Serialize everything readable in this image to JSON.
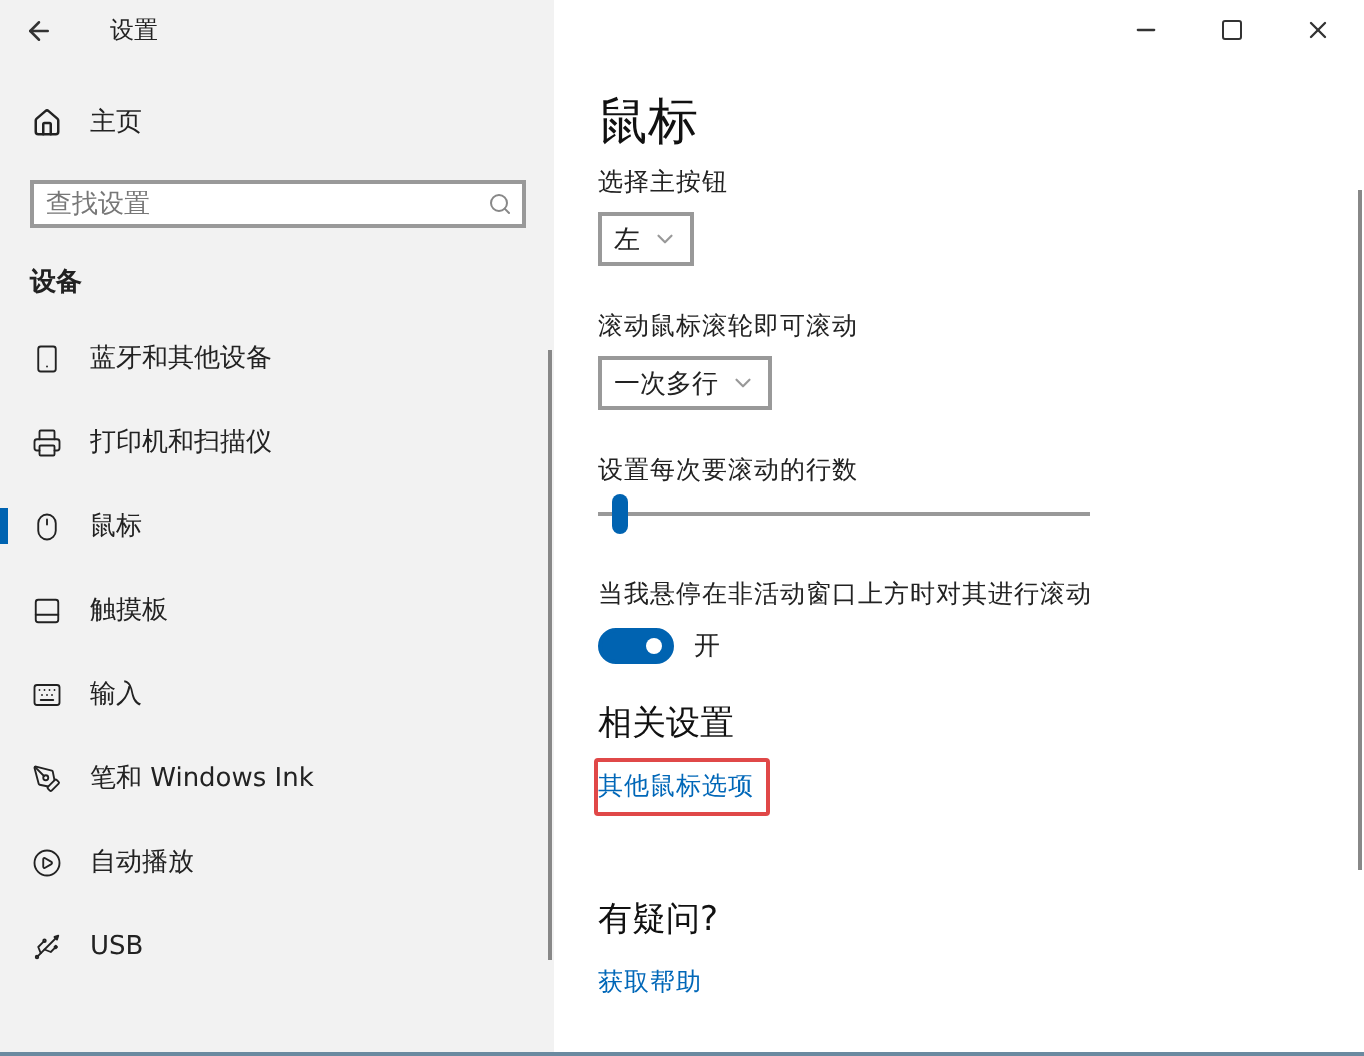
{
  "window": {
    "title": "设置"
  },
  "sidebar": {
    "home": "主页",
    "search": {
      "placeholder": "查找设置"
    },
    "section": "设备",
    "items": [
      {
        "label": "蓝牙和其他设备",
        "selected": false
      },
      {
        "label": "打印机和扫描仪",
        "selected": false
      },
      {
        "label": "鼠标",
        "selected": true
      },
      {
        "label": "触摸板",
        "selected": false
      },
      {
        "label": "输入",
        "selected": false
      },
      {
        "label": "笔和 Windows Ink",
        "selected": false
      },
      {
        "label": "自动播放",
        "selected": false
      },
      {
        "label": "USB",
        "selected": false
      }
    ]
  },
  "page": {
    "title": "鼠标",
    "settings": [
      {
        "kind": "dropdown",
        "label": "选择主按钮",
        "value": "左"
      },
      {
        "kind": "dropdown",
        "label": "滚动鼠标滚轮即可滚动",
        "value": "一次多行"
      },
      {
        "kind": "slider",
        "label": "设置每次要滚动的行数",
        "level": 0.03
      },
      {
        "kind": "toggle",
        "label": "当我悬停在非活动窗口上方时对其进行滚动",
        "on": true,
        "state_text": "开"
      }
    ],
    "related": {
      "title": "相关设置",
      "link": {
        "label": "其他鼠标选项",
        "highlighted": true
      }
    },
    "help": {
      "title": "有疑问?",
      "link": "获取帮助"
    }
  }
}
